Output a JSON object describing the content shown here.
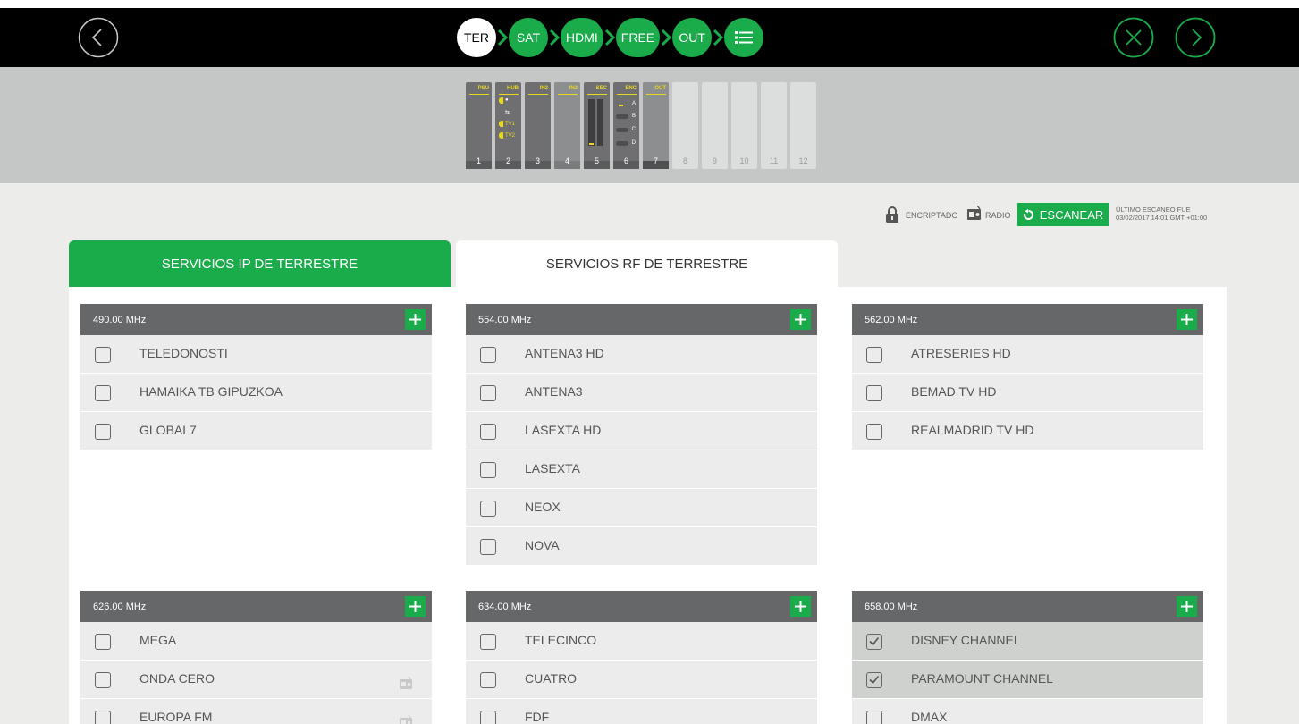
{
  "nav": {
    "steps": [
      "TER",
      "SAT",
      "HDMI",
      "FREE",
      "OUT",
      "list-icon"
    ]
  },
  "slots": [
    {
      "label": "PSU",
      "num": "1"
    },
    {
      "label": "HUB",
      "num": "2"
    },
    {
      "label": "IN2",
      "num": "3"
    },
    {
      "label": "IN2",
      "num": "4"
    },
    {
      "label": "SEC",
      "num": "5"
    },
    {
      "label": "ENC",
      "num": "6"
    },
    {
      "label": "OUT",
      "num": "7"
    },
    {
      "label": "",
      "num": "8"
    },
    {
      "label": "",
      "num": "9"
    },
    {
      "label": "",
      "num": "10"
    },
    {
      "label": "",
      "num": "11"
    },
    {
      "label": "",
      "num": "12"
    }
  ],
  "hub_labels": [
    "TV1",
    "TV2"
  ],
  "enc_labels": [
    "A",
    "B",
    "C",
    "D"
  ],
  "status": {
    "encrypted_label": "ENCRIPTADO",
    "radio_label": "RADIO",
    "scan_label": "ESCANEAR",
    "last_scan_line1": "ÚLTIMO ESCANEO FUE",
    "last_scan_line2": "03/02/2017 14:01 GMT +01:00"
  },
  "tabs": {
    "ip": "SERVICIOS IP DE TERRESTRE",
    "rf": "SERVICIOS RF DE TERRESTRE"
  },
  "colors": {
    "accent": "#1aab4b",
    "header": "#666768",
    "bar": "#000000"
  },
  "panels": [
    {
      "freq": "490.00 MHz",
      "rows": [
        {
          "name": "TELEDONOSTI",
          "checked": false,
          "radio": false
        },
        {
          "name": "HAMAIKA TB GIPUZKOA",
          "checked": false,
          "radio": false
        },
        {
          "name": "GLOBAL7",
          "checked": false,
          "radio": false
        }
      ]
    },
    {
      "freq": "554.00 MHz",
      "rows": [
        {
          "name": "ANTENA3 HD",
          "checked": false,
          "radio": false
        },
        {
          "name": "ANTENA3",
          "checked": false,
          "radio": false
        },
        {
          "name": "LASEXTA HD",
          "checked": false,
          "radio": false
        },
        {
          "name": "LASEXTA",
          "checked": false,
          "radio": false
        },
        {
          "name": "NEOX",
          "checked": false,
          "radio": false
        },
        {
          "name": "NOVA",
          "checked": false,
          "radio": false
        }
      ]
    },
    {
      "freq": "562.00 MHz",
      "rows": [
        {
          "name": "ATRESERIES HD",
          "checked": false,
          "radio": false
        },
        {
          "name": "BEMAD TV HD",
          "checked": false,
          "radio": false
        },
        {
          "name": "REALMADRID TV HD",
          "checked": false,
          "radio": false
        }
      ]
    },
    {
      "freq": "626.00 MHz",
      "rows": [
        {
          "name": "MEGA",
          "checked": false,
          "radio": false
        },
        {
          "name": "ONDA CERO",
          "checked": false,
          "radio": true
        },
        {
          "name": "EUROPA FM",
          "checked": false,
          "radio": true
        }
      ]
    },
    {
      "freq": "634.00 MHz",
      "rows": [
        {
          "name": "TELECINCO",
          "checked": false,
          "radio": false
        },
        {
          "name": "CUATRO",
          "checked": false,
          "radio": false
        },
        {
          "name": "FDF",
          "checked": false,
          "radio": false
        }
      ]
    },
    {
      "freq": "658.00 MHz",
      "rows": [
        {
          "name": "DISNEY CHANNEL",
          "checked": true,
          "radio": false
        },
        {
          "name": "PARAMOUNT CHANNEL",
          "checked": true,
          "radio": false
        },
        {
          "name": "DMAX",
          "checked": false,
          "radio": false
        }
      ]
    }
  ]
}
